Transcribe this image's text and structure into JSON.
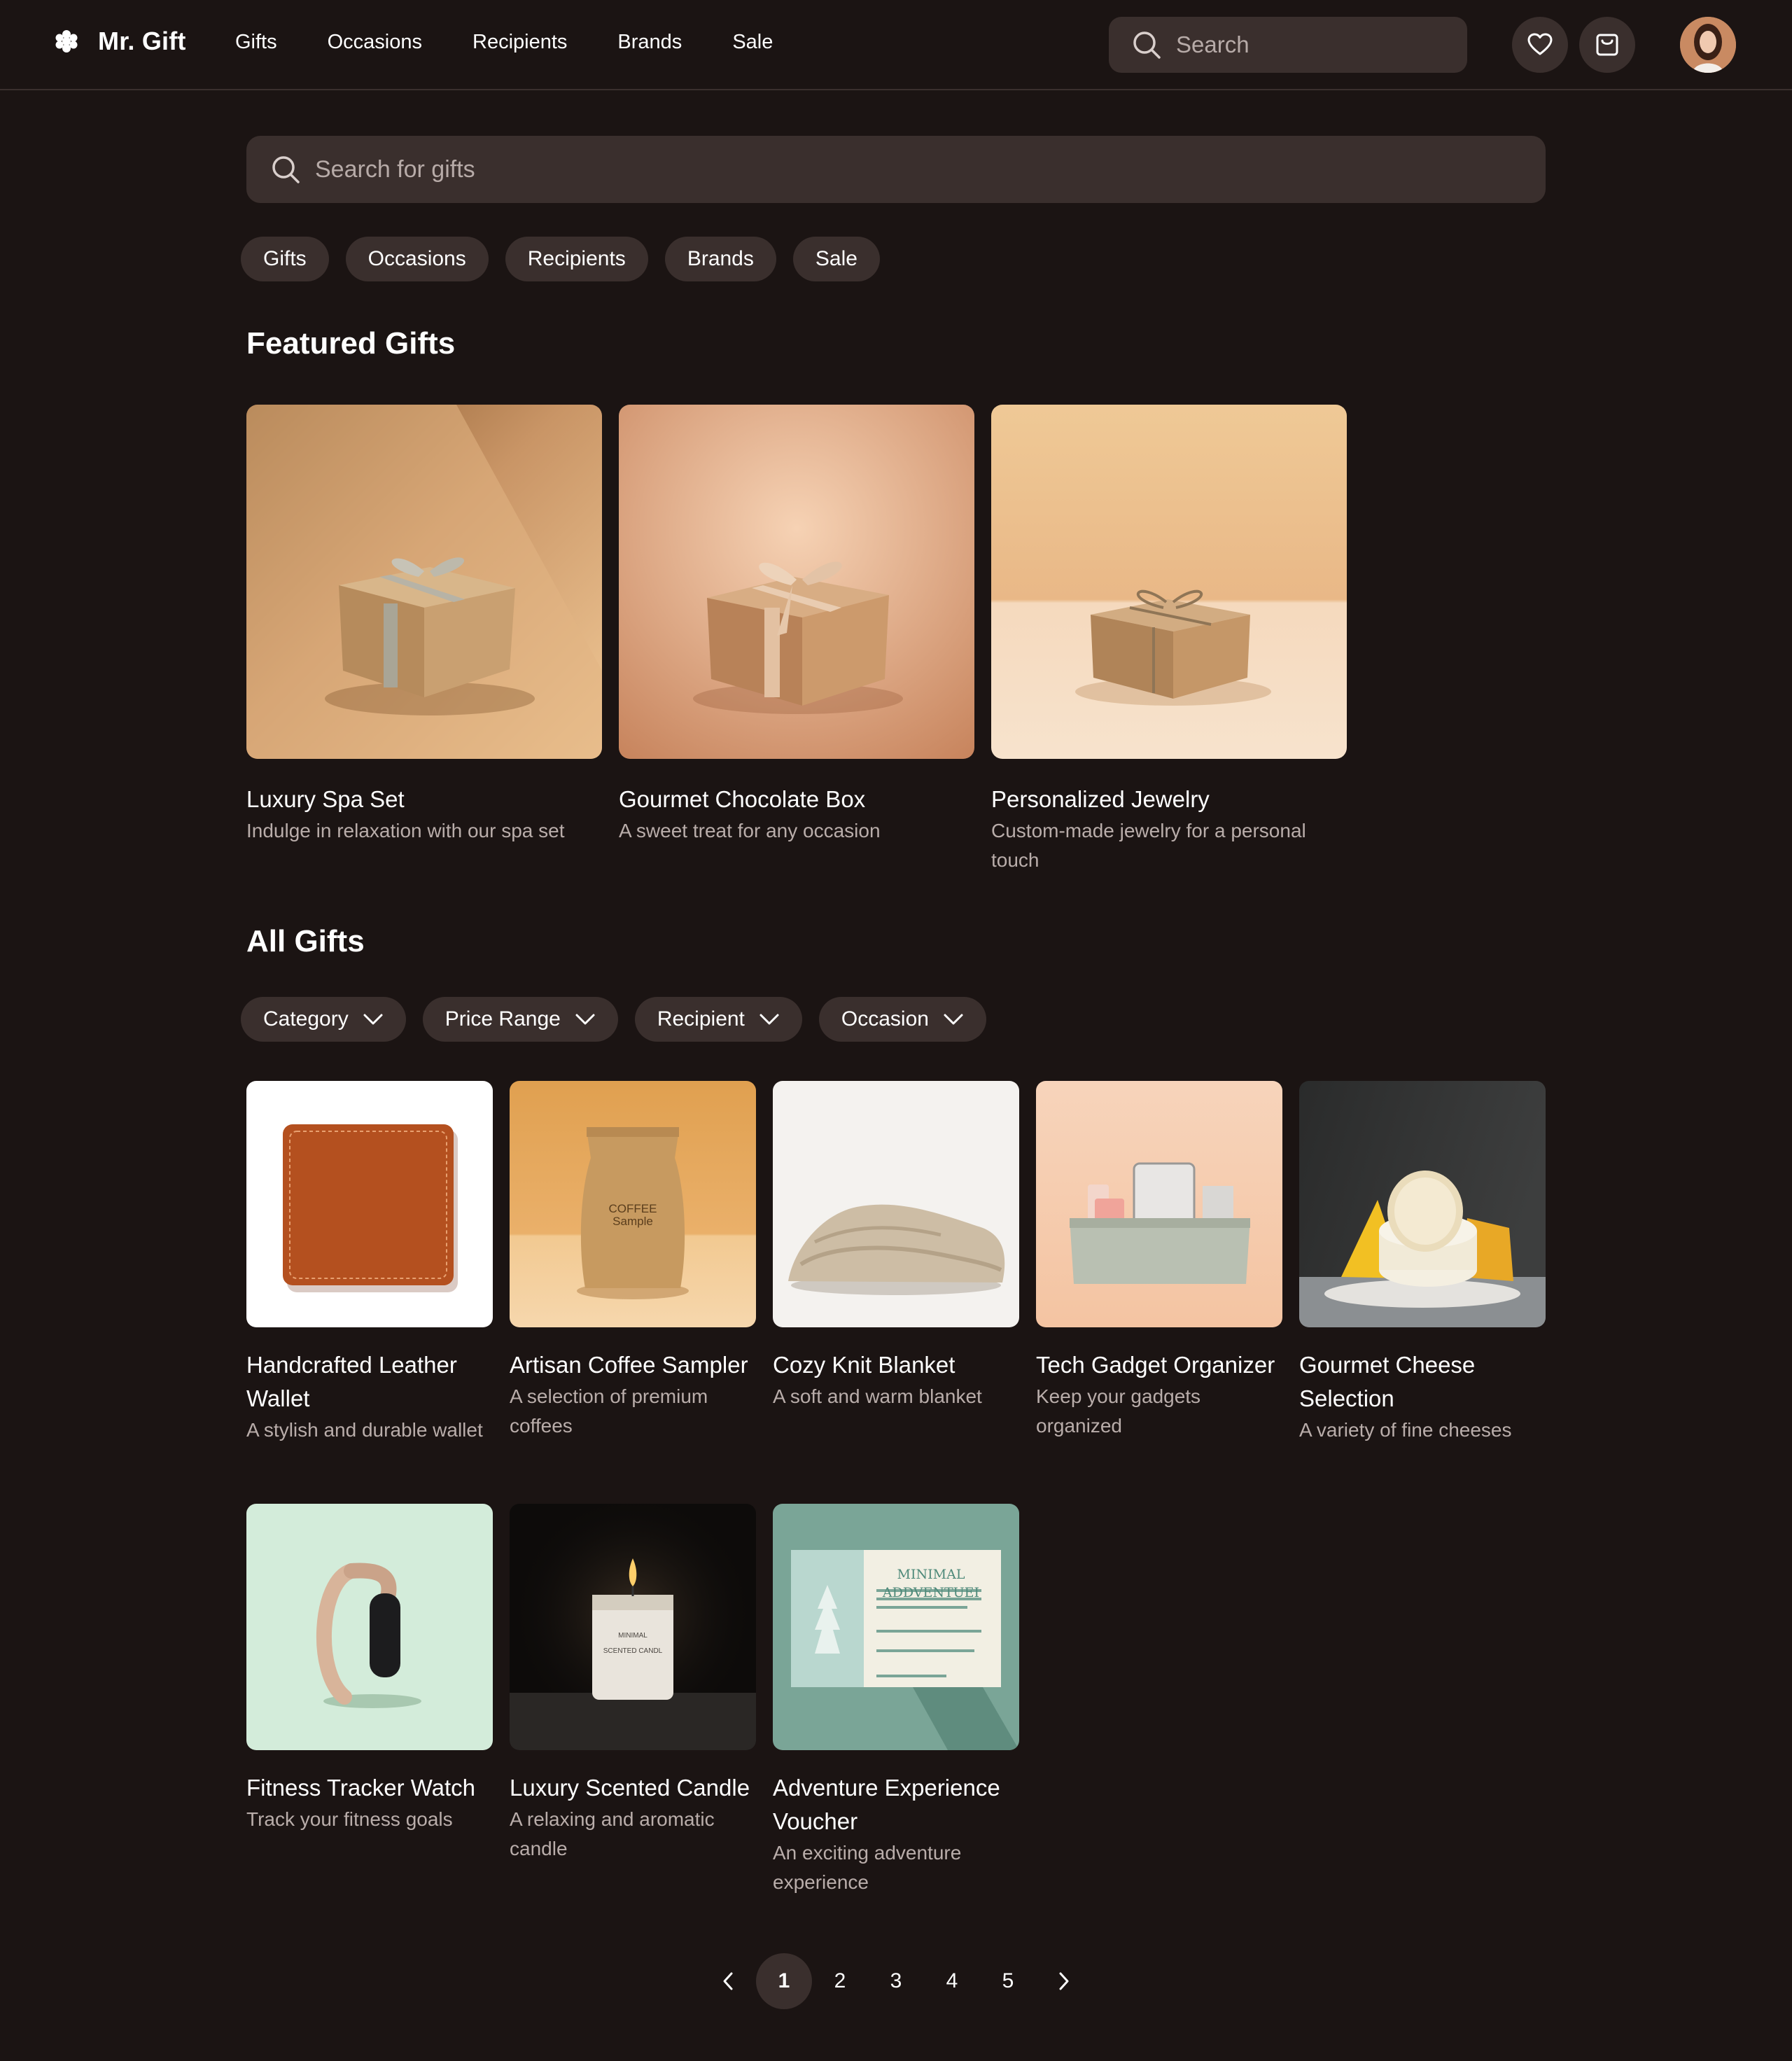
{
  "header": {
    "brand": "Mr. Gift",
    "nav": [
      "Gifts",
      "Occasions",
      "Recipients",
      "Brands",
      "Sale"
    ],
    "search_placeholder": "Search"
  },
  "main_search": {
    "placeholder": "Search for gifts"
  },
  "chips": [
    "Gifts",
    "Occasions",
    "Recipients",
    "Brands",
    "Sale"
  ],
  "featured": {
    "title": "Featured Gifts",
    "items": [
      {
        "title": "Luxury Spa Set",
        "desc": "Indulge in relaxation with our spa set"
      },
      {
        "title": "Gourmet Chocolate Box",
        "desc": "A sweet treat for any occasion"
      },
      {
        "title": "Personalized Jewelry",
        "desc": "Custom-made jewelry for a personal touch"
      }
    ]
  },
  "all_gifts": {
    "title": "All Gifts",
    "filters": [
      "Category",
      "Price Range",
      "Recipient",
      "Occasion"
    ],
    "items": [
      {
        "title": "Handcrafted Leather Wallet",
        "desc": "A stylish and durable wallet"
      },
      {
        "title": "Artisan Coffee Sampler",
        "desc": "A selection of premium coffees"
      },
      {
        "title": "Cozy Knit Blanket",
        "desc": "A soft and warm blanket"
      },
      {
        "title": "Tech Gadget Organizer",
        "desc": "Keep your gadgets organized"
      },
      {
        "title": "Gourmet Cheese Selection",
        "desc": "A variety of fine cheeses"
      },
      {
        "title": "Fitness Tracker Watch",
        "desc": "Track your fitness goals"
      },
      {
        "title": "Luxury Scented Candle",
        "desc": "A relaxing and aromatic candle"
      },
      {
        "title": "Adventure Experience Voucher",
        "desc": "An exciting adventure experience"
      }
    ],
    "image_text": {
      "coffee_bag": [
        "COFFEE",
        "Sample"
      ],
      "candle": [
        "MINIMAL",
        "SCENTED CANDL"
      ],
      "voucher": [
        "MINIMAL",
        "ADDVENTUEI"
      ]
    }
  },
  "pagination": {
    "pages": [
      "1",
      "2",
      "3",
      "4",
      "5"
    ],
    "current": "1"
  },
  "colors": {
    "background": "#1b1413",
    "surface": "#3a2f2d",
    "muted_text": "#b9adaa"
  }
}
